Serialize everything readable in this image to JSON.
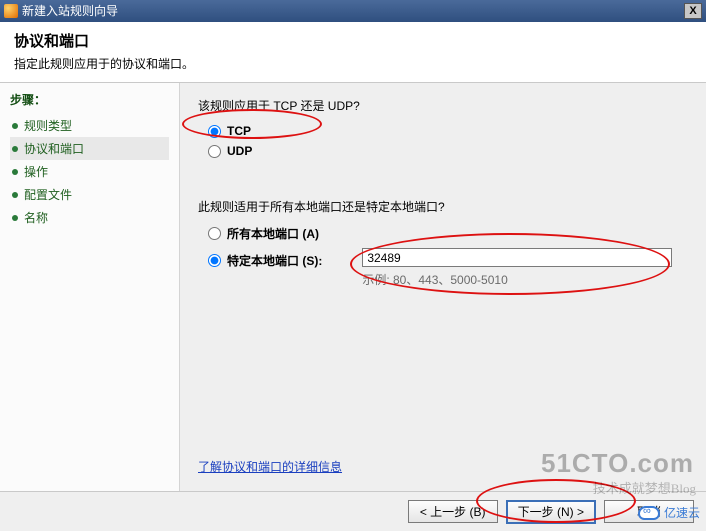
{
  "titlebar": {
    "title": "新建入站规则向导"
  },
  "header": {
    "title": "协议和端口",
    "subtitle": "指定此规则应用于的协议和端口。"
  },
  "steps": {
    "heading": "步骤：",
    "items": [
      {
        "label": "规则类型",
        "active": false
      },
      {
        "label": "协议和端口",
        "active": true
      },
      {
        "label": "操作",
        "active": false
      },
      {
        "label": "配置文件",
        "active": false
      },
      {
        "label": "名称",
        "active": false
      }
    ]
  },
  "main": {
    "protocol_question": "该规则应用于 TCP 还是 UDP?",
    "protocol": {
      "tcp_label": "TCP",
      "udp_label": "UDP",
      "selected": "tcp"
    },
    "port_question": "此规则适用于所有本地端口还是特定本地端口?",
    "port_scope": {
      "all_label": "所有本地端口 (A)",
      "specific_label": "特定本地端口 (S):",
      "selected": "specific",
      "specific_value": "32489",
      "example_text": "示例: 80、443、5000-5010"
    },
    "learn_more": "了解协议和端口的详细信息"
  },
  "footer": {
    "back": "< 上一步 (B)",
    "next": "下一步 (N) >",
    "cancel": "取消"
  },
  "watermark": {
    "line1": "51CTO.com",
    "line2": "技术成就梦想Blog",
    "badge": "亿速云"
  }
}
